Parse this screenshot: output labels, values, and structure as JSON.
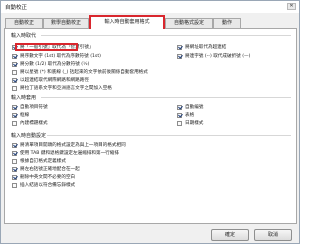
{
  "window": {
    "title": "自動校正",
    "close_glyph": "✕"
  },
  "tabs": [
    "自動校正",
    "數學自動校正",
    "輸入時自動套用格式",
    "自動格式設定",
    "動作"
  ],
  "sections": {
    "replace_head": "輸入時取代",
    "apply_head": "輸入時套用",
    "auto_head": "輸入時自動設定"
  },
  "replace_items": [
    {
      "label": "將「一般引號」取代為「智慧引號」",
      "checked": true
    },
    {
      "label": "將序數文字 (1st) 取代為序數符號 (1st)",
      "checked": true
    },
    {
      "label": "將分數 (1/2) 取代為分數符號 (½)",
      "checked": true
    },
    {
      "label": "將以星號 (*) 和底線 (_) 括起來的文字依前後關係自動套用格式",
      "checked": false
    },
    {
      "label": "以超連結取代網際網路和網路路徑",
      "checked": true
    },
    {
      "label": "將拉丁語系文字和亞洲語言文字之間加入空格",
      "checked": false
    },
    {
      "label": "將網址取代為超連結",
      "checked": true
    },
    {
      "label": "將連字號 (--) 取代成破折號 (—)",
      "checked": true
    }
  ],
  "apply_items": [
    {
      "label": "自動項目符號",
      "checked": true
    },
    {
      "label": "自動編號",
      "checked": true
    },
    {
      "label": "框線",
      "checked": true
    },
    {
      "label": "表格",
      "checked": true
    },
    {
      "label": "內建標題樣式",
      "checked": false
    },
    {
      "label": "日期樣式",
      "checked": false
    }
  ],
  "auto_items": [
    {
      "label": "將清單項目開頭的格式設定為與上一項目的格式相同",
      "checked": true
    },
    {
      "label": "使用 TAB 鍵和退格鍵設定左邊縮排和第一行縮排",
      "checked": true
    },
    {
      "label": "根據自訂格式定義樣式",
      "checked": false
    },
    {
      "label": "將左右括號正確地配合在一起",
      "checked": true
    },
    {
      "label": "刪除中英文間不必要的空白",
      "checked": true
    },
    {
      "label": "插入結語以符合備忘錄樣式",
      "checked": false
    }
  ],
  "buttons": {
    "ok": "確定",
    "cancel": "取消"
  }
}
